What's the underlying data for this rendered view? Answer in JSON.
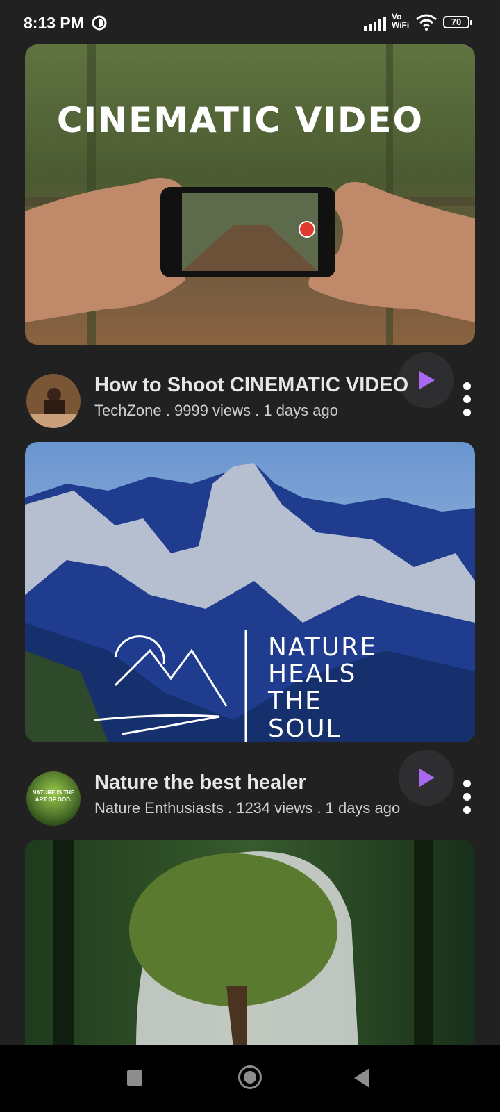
{
  "status_bar": {
    "time": "8:13 PM",
    "network_label": "Vo WiFi",
    "battery": "70"
  },
  "videos": [
    {
      "thumbnail_text": "CINEMATIC VIDEO",
      "title": "How to Shoot CINEMATIC VIDEO",
      "channel": "TechZone",
      "views": "9999 views",
      "age": "1 days ago",
      "subtitle": "TechZone . 9999 views . 1 days ago"
    },
    {
      "thumbnail_text": [
        "NATURE",
        "HEALS",
        "THE",
        "SOUL"
      ],
      "avatar_text": "NATURE IS THE ART OF GOD.",
      "title": "Nature the best healer",
      "channel": "Nature Enthusiasts",
      "views": "1234 views",
      "age": "1 days ago",
      "subtitle": "Nature Enthusiasts . 1234 views . 1 days ago"
    },
    {
      "title": "",
      "subtitle": ""
    }
  ],
  "colors": {
    "background": "#212122",
    "play_accent": "#a868f0",
    "nav_bar": "#000000"
  },
  "icons": {
    "play": "play-icon",
    "more": "more-vertical-icon",
    "nav_recent": "square-icon",
    "nav_home": "circle-icon",
    "nav_back": "triangle-back-icon"
  }
}
